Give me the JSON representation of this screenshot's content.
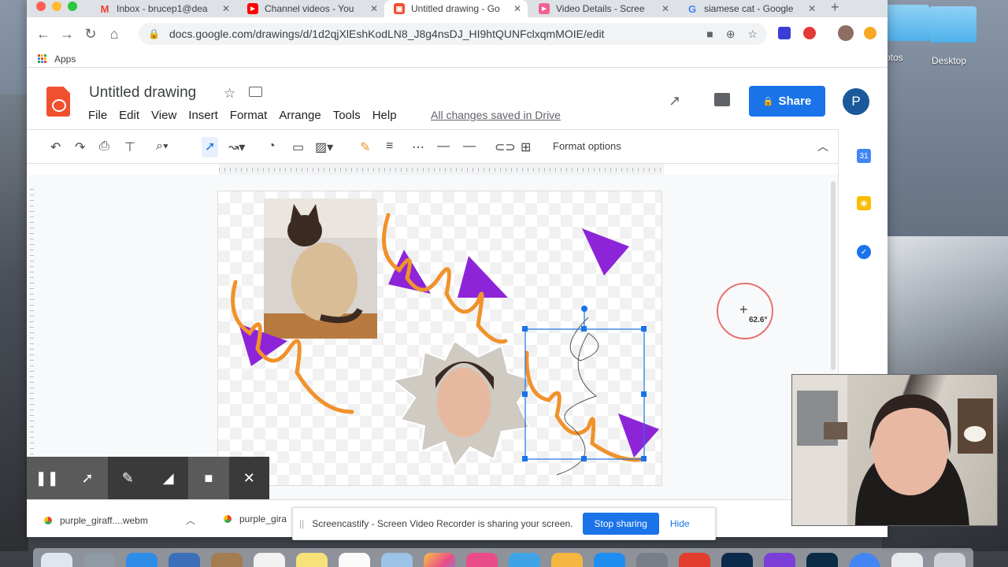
{
  "browser": {
    "tabs": [
      {
        "label": "Inbox - brucep1@dea",
        "favicon": "gmail-icon",
        "color": "#ea4335",
        "glyph": "M"
      },
      {
        "label": "Channel videos - You",
        "favicon": "youtube-icon",
        "color": "#ff0000",
        "glyph": "▶"
      },
      {
        "label": "Untitled drawing - Go",
        "favicon": "google-drawings-icon",
        "color": "#f1502f",
        "glyph": "▣",
        "active": true
      },
      {
        "label": "Video Details - Scree",
        "favicon": "screencastify-icon",
        "color": "#f06292",
        "glyph": "▶"
      },
      {
        "label": "siamese cat - Google",
        "favicon": "google-icon",
        "color": "#4285f4",
        "glyph": "G"
      }
    ],
    "new_tab": "+",
    "url": "docs.google.com/drawings/d/1d2qjXlEshKodLN8_J8g4nsDJ_HI9htQUNFclxqmMOIE/edit",
    "bookmarks_apps": "Apps"
  },
  "desktop": {
    "folder_label_1": "otos",
    "folder_label_2": "Desktop"
  },
  "docs": {
    "title": "Untitled drawing",
    "menu": [
      "File",
      "Edit",
      "View",
      "Insert",
      "Format",
      "Arrange",
      "Tools",
      "Help"
    ],
    "saved_status": "All changes saved in Drive",
    "share_label": "Share",
    "avatar_initial": "P",
    "format_options": "Format options"
  },
  "canvas": {
    "rotation_readout": "62.6°"
  },
  "downloads": [
    {
      "name": "purple_giraff....webm"
    },
    {
      "name": "purple_gira"
    }
  ],
  "sharing_bar": {
    "message": "Screencastify - Screen Video Recorder is sharing your screen.",
    "stop_label": "Stop sharing",
    "hide_label": "Hide"
  },
  "colors": {
    "accent": "#1a73e8",
    "drawings_brand": "#f1502f",
    "squiggle": "#f0922c",
    "triangle": "#8e24d8",
    "selection": "#1a73e8"
  }
}
